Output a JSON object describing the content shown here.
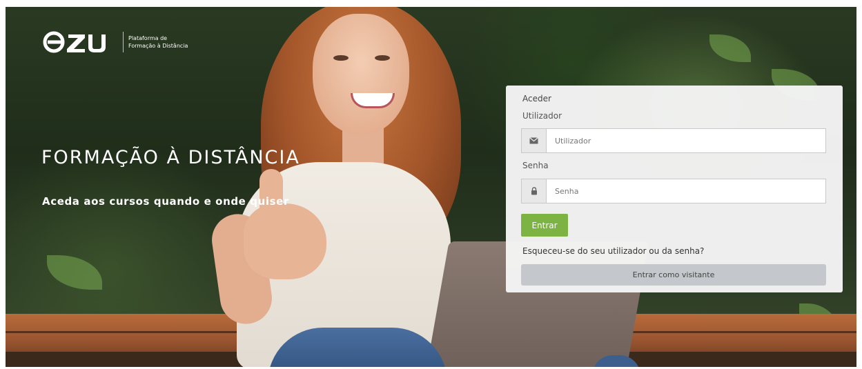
{
  "brand": {
    "logo_text": "ezu",
    "tagline_line1": "Plataforma de",
    "tagline_line2": "Formação à Distância"
  },
  "hero": {
    "headline": "FORMAÇÃO À DISTÂNCIA",
    "subline": "Aceda aos cursos quando e onde quiser"
  },
  "login": {
    "title": "Aceder",
    "username_label": "Utilizador",
    "username_placeholder": "Utilizador",
    "username_icon": "envelope-icon",
    "password_label": "Senha",
    "password_placeholder": "Senha",
    "password_icon": "lock-icon",
    "submit_label": "Entrar",
    "submit_color": "#7cb342",
    "forgot_link": "Esqueceu-se do seu utilizador ou da senha?",
    "guest_label": "Entrar como visitante"
  }
}
